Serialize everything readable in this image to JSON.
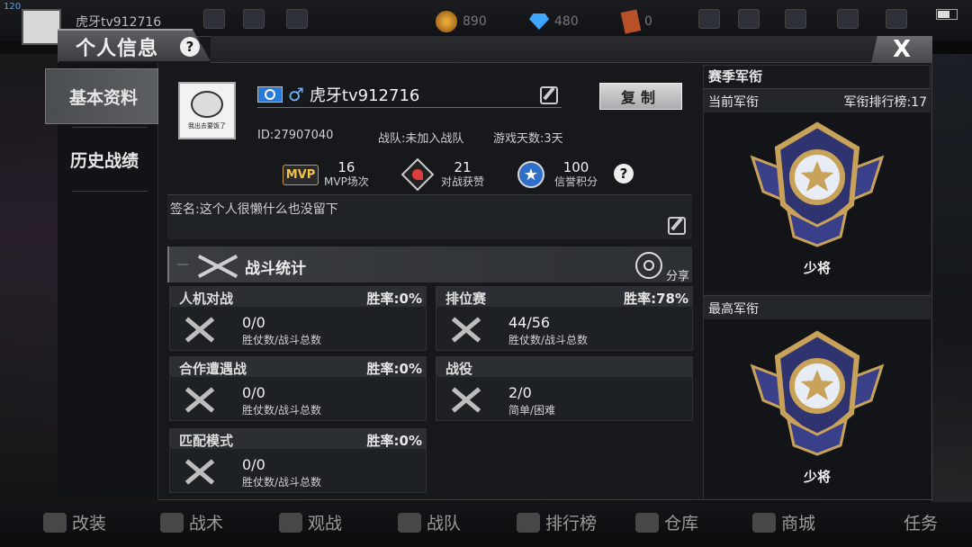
{
  "hud": {
    "fps": "120",
    "player_name": "虎牙tv912716",
    "gold": "890",
    "diamond": "480",
    "ticket": "0"
  },
  "window": {
    "title": "个人信息",
    "help": "?",
    "close": "X"
  },
  "menu": [
    {
      "label": "基本资料"
    },
    {
      "label": "历史战绩"
    }
  ],
  "profile": {
    "avatar_caption": "我出去要饭了",
    "gender": "♂",
    "nickname": "虎牙tv912716",
    "copy_label": "复制",
    "id_text": "ID:27907040",
    "clan_text": "战队:未加入战队",
    "days_text": "游戏天数:3天",
    "signature": "签名:这个人很懒什么也没留下"
  },
  "stats": [
    {
      "icon": "mvp-icon",
      "badge": "MVP",
      "value": "16",
      "label": "MVP场次"
    },
    {
      "icon": "heart-icon",
      "value": "21",
      "label": "对战获赞"
    },
    {
      "icon": "star-icon",
      "value": "100",
      "label": "信誉积分"
    }
  ],
  "stats_help": "?",
  "battle": {
    "dash": "—",
    "title": "战斗统计",
    "share": "分享"
  },
  "cards": [
    {
      "name": "人机对战",
      "rate": "胜率:0%",
      "value": "0/0",
      "sub": "胜仗数/战斗总数"
    },
    {
      "name": "排位赛",
      "rate": "胜率:78%",
      "value": "44/56",
      "sub": "胜仗数/战斗总数"
    },
    {
      "name": "合作遭遇战",
      "rate": "胜率:0%",
      "value": "0/0",
      "sub": "胜仗数/战斗总数"
    },
    {
      "name": "战役",
      "rate": "",
      "value": "2/0",
      "sub": "简单/困难"
    },
    {
      "name": "匹配模式",
      "rate": "胜率:0%",
      "value": "0/0",
      "sub": "胜仗数/战斗总数"
    }
  ],
  "rank": {
    "title": "赛季军衔",
    "current_label": "当前军衔",
    "board_text": "军衔排行榜:17",
    "current_name": "少将",
    "highest_label": "最高军衔",
    "highest_name": "少将"
  },
  "bottom_nav": [
    {
      "label": "改装"
    },
    {
      "label": "战术"
    },
    {
      "label": "观战"
    },
    {
      "label": "战队"
    },
    {
      "label": "排行榜"
    },
    {
      "label": "仓库"
    },
    {
      "label": "商城"
    },
    {
      "label": "任务"
    }
  ],
  "colors": {
    "accent_blue": "#2f6fc9",
    "heart_red": "#e23d3d",
    "mvp_gold": "#f1c34a",
    "medal_gold": "#c9a25a",
    "medal_blue": "#3a3f8a"
  }
}
